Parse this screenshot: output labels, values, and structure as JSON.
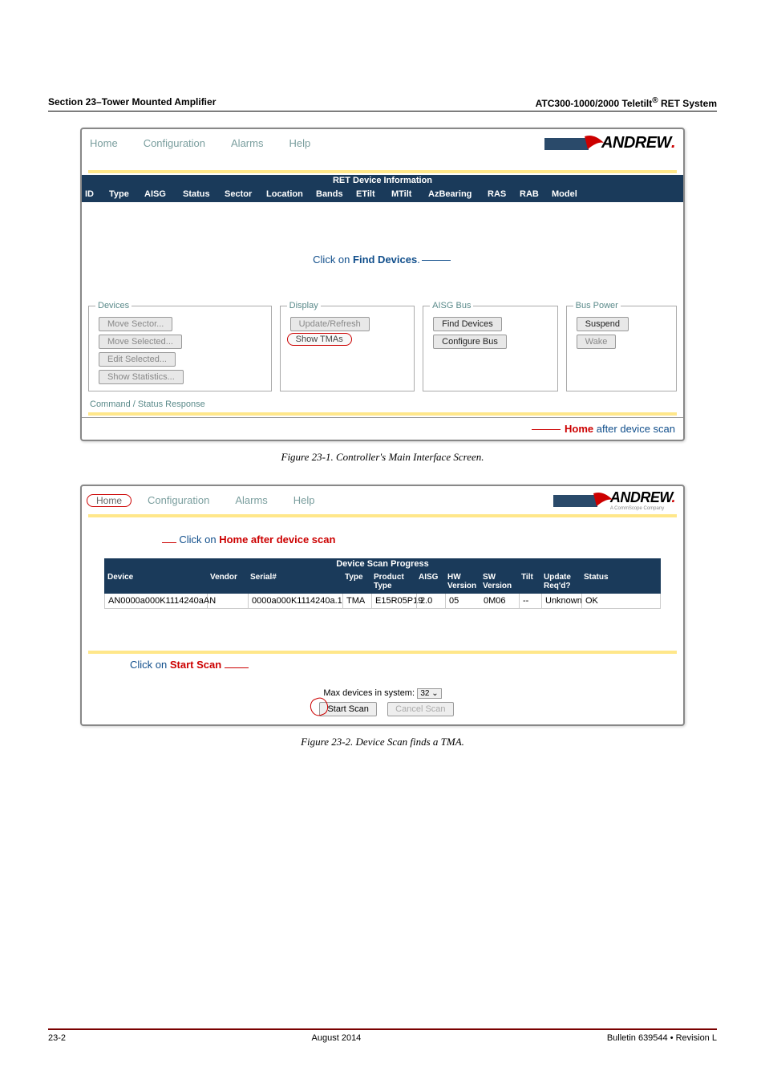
{
  "header": {
    "left": "Section 23–Tower Mounted Amplifier",
    "right_prefix": "ATC300-1000/2000 Teletilt",
    "right_suffix": " RET System"
  },
  "fig1": {
    "menu": {
      "home": "Home",
      "config": "Configuration",
      "alarms": "Alarms",
      "help": "Help"
    },
    "logo": "ANDREW",
    "table_title": "RET Device Information",
    "cols": {
      "id": "ID",
      "type": "Type",
      "aisg": "AISG",
      "status": "Status",
      "sector": "Sector",
      "location": "Location",
      "bands": "Bands",
      "etilt": "ETilt",
      "mtilt": "MTilt",
      "azbearing": "AzBearing",
      "ras": "RAS",
      "rab": "RAB",
      "model": "Model"
    },
    "mid_pre": "Click on ",
    "mid_bold": "Find Devices",
    "devices_legend": "Devices",
    "display_legend": "Display",
    "aisg_legend": "AISG Bus",
    "bus_legend": "Bus Power",
    "btns": {
      "move_sector": "Move Sector...",
      "move_selected": "Move Selected...",
      "edit_selected": "Edit Selected...",
      "show_stats": "Show Statistics...",
      "update": "Update/Refresh",
      "show_tmas": "Show TMAs",
      "find": "Find Devices",
      "conf": "Configure Bus",
      "suspend": "Suspend",
      "wake": "Wake"
    },
    "cmd_label": "Command / Status Response",
    "note_pre": "Home",
    "note_post": " after device scan",
    "caption": "Figure 23-1.  Controller's Main Interface Screen."
  },
  "fig2": {
    "menu": {
      "home": "Home",
      "config": "Configuration",
      "alarms": "Alarms",
      "help": "Help"
    },
    "logo": "ANDREW",
    "logo_sub": "A CommScope Company",
    "note1_pre": "Click on ",
    "note1_bold": "Home after device scan",
    "table_title": "Device Scan Progress",
    "cols": {
      "device": "Device",
      "vendor": "Vendor",
      "serial": "Serial#",
      "type": "Type",
      "ptype": "Product Type",
      "aisg": "AISG",
      "hw": "HW Version",
      "sw": "SW Version",
      "tilt": "Tilt",
      "upd": "Update Req'd?",
      "status": "Status"
    },
    "row": {
      "device": "AN0000a000K1114240aAN",
      "vendor": "",
      "serial": "0000a000K1114240a.1",
      "type": "TMA",
      "ptype": "E15R05P19",
      "aisg": "2.0",
      "hw": "05",
      "sw": "0M06",
      "tilt": "--",
      "upd": "Unknown",
      "status": "OK"
    },
    "note2_pre": "Click on ",
    "note2_bold": "Start Scan",
    "maxdev_label": "Max devices in system:",
    "maxdev_val": "32 ⌄",
    "start_scan": "Start Scan",
    "cancel_scan": "Cancel Scan",
    "caption": "Figure 23-2.  Device Scan finds a TMA."
  },
  "footer": {
    "left": "23-2",
    "center": "August 2014",
    "right": "Bulletin 639544  •  Revision L"
  }
}
